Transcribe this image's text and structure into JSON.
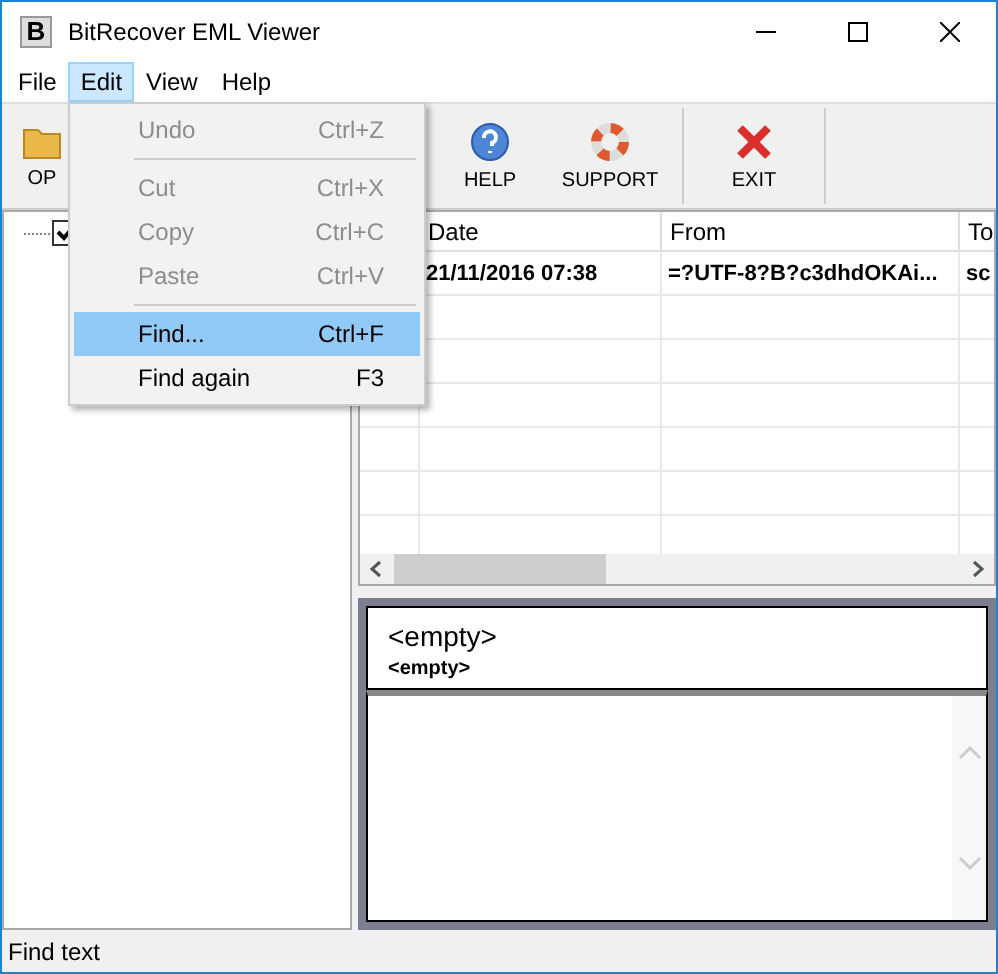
{
  "window": {
    "title": "BitRecover EML Viewer",
    "logo_letter": "B"
  },
  "menu_bar": [
    {
      "label": "File",
      "selected": false
    },
    {
      "label": "Edit",
      "selected": true
    },
    {
      "label": "View",
      "selected": false
    },
    {
      "label": "Help",
      "selected": false
    }
  ],
  "edit_menu": [
    {
      "kind": "item",
      "label": "Undo",
      "shortcut": "Ctrl+Z",
      "disabled": true,
      "selected": false
    },
    {
      "kind": "separator"
    },
    {
      "kind": "item",
      "label": "Cut",
      "shortcut": "Ctrl+X",
      "disabled": true,
      "selected": false
    },
    {
      "kind": "item",
      "label": "Copy",
      "shortcut": "Ctrl+C",
      "disabled": true,
      "selected": false
    },
    {
      "kind": "item",
      "label": "Paste",
      "shortcut": "Ctrl+V",
      "disabled": true,
      "selected": false
    },
    {
      "kind": "separator"
    },
    {
      "kind": "item",
      "label": "Find...",
      "shortcut": "Ctrl+F",
      "disabled": false,
      "selected": true
    },
    {
      "kind": "item",
      "label": "Find again",
      "shortcut": "F3",
      "disabled": false,
      "selected": false
    }
  ],
  "toolbar": [
    {
      "kind": "open",
      "label": "OP"
    },
    {
      "kind": "help",
      "label": "HELP"
    },
    {
      "kind": "support",
      "label": "SUPPORT"
    },
    {
      "kind": "exit",
      "label": "EXIT"
    }
  ],
  "tree": {
    "checked": true
  },
  "table": {
    "columns": [
      "",
      "Date",
      "From",
      "To"
    ],
    "rows": [
      {
        "cells": [
          "",
          "21/11/2016 07:38",
          "=?UTF-8?B?c3dhdOKAi...",
          "sc"
        ]
      }
    ]
  },
  "preview": {
    "subject": "<empty>",
    "sender": "<empty>"
  },
  "status_bar": "Find text"
}
